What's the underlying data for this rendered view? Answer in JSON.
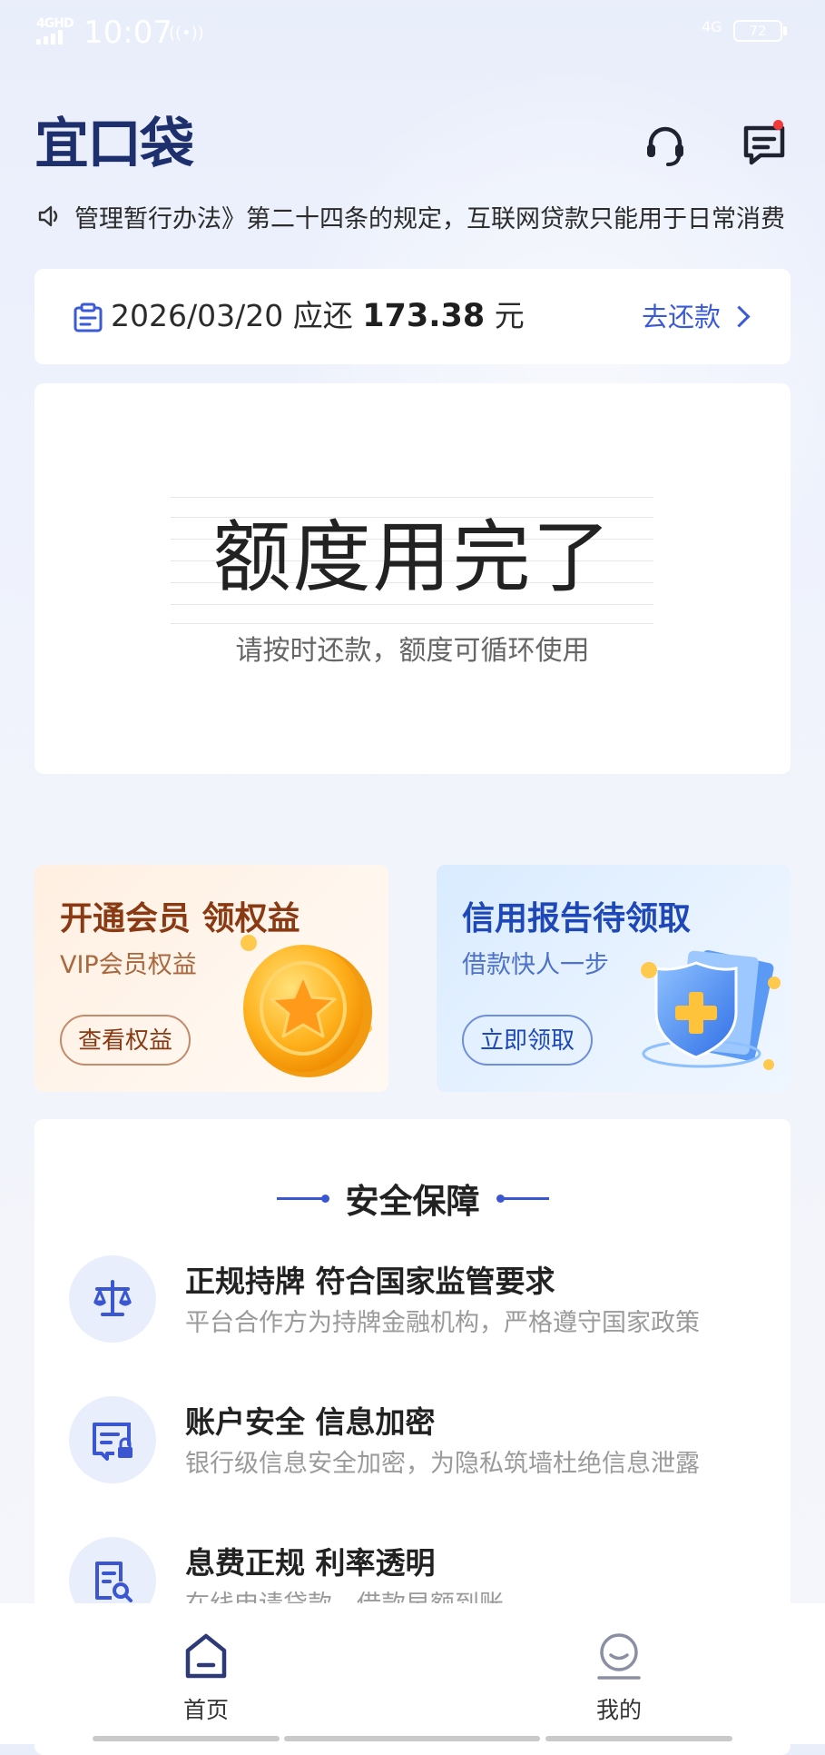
{
  "status_bar": {
    "network": "4GHD",
    "time": "10:07",
    "network_right": "4G",
    "battery": "72"
  },
  "header": {
    "app_name": "宜口袋",
    "support_icon": "headset-icon",
    "message_icon": "message-icon"
  },
  "notice": {
    "icon": "speaker-icon",
    "text": "管理暂行办法》第二十四条的规定，互联网贷款只能用于日常消费"
  },
  "repayment": {
    "icon": "calendar-icon",
    "date": "2026/03/20",
    "due_label": "应还",
    "amount": "173.38",
    "unit": "元",
    "action": "去还款"
  },
  "quota": {
    "title": "额度用完了",
    "subtitle": "请按时还款，额度可循环使用"
  },
  "promos": {
    "vip": {
      "title": "开通会员 领权益",
      "subtitle": "VIP会员权益",
      "button": "查看权益",
      "icon": "coin-star-icon"
    },
    "credit": {
      "title": "信用报告待领取",
      "subtitle": "借款快人一步",
      "button": "立即领取",
      "icon": "shield-plus-icon"
    }
  },
  "security": {
    "title": "安全保障",
    "items": [
      {
        "title": "正规持牌 符合国家监管要求",
        "desc": "平台合作方为持牌金融机构，严格遵守国家政策",
        "icon": "scale-icon"
      },
      {
        "title": "账户安全 信息加密",
        "desc": "银行级信息安全加密，为隐私筑墙杜绝信息泄露",
        "icon": "card-lock-icon"
      },
      {
        "title": "息费正规  利率透明",
        "desc": "在线申请贷款，借款早额到账",
        "icon": "document-search-icon"
      }
    ]
  },
  "nav": {
    "home": "首页",
    "mine": "我的"
  },
  "colors": {
    "brand_dark": "#1e2f6e",
    "accent_blue": "#3b5bd6",
    "vip_brown": "#8a3a12",
    "alert_red": "#f23a3a"
  }
}
